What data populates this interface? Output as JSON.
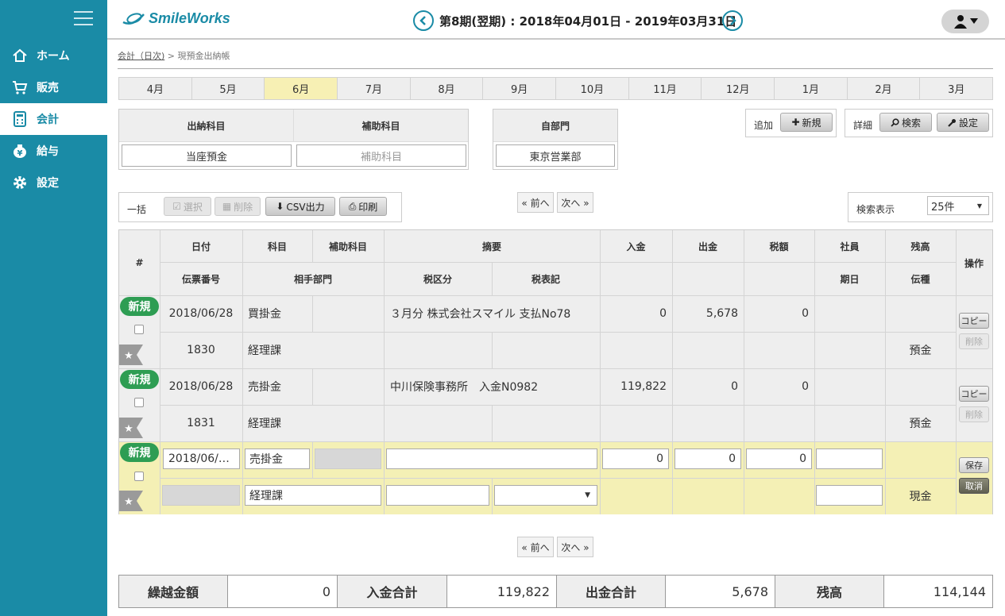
{
  "app": {
    "logo": "SmileWorks"
  },
  "sidebar": {
    "items": [
      {
        "label": "ホーム",
        "icon": "home-icon"
      },
      {
        "label": "販売",
        "icon": "cart-icon"
      },
      {
        "label": "会計",
        "icon": "calculator-icon",
        "active": true
      },
      {
        "label": "給与",
        "icon": "yen-bag-icon"
      },
      {
        "label": "設定",
        "icon": "gear-icon"
      }
    ]
  },
  "header": {
    "period": "第8期(翌期) : 2018年04月01日 - 2019年03月31日"
  },
  "breadcrumb": {
    "parent": "会計（日次)",
    "separator": ">",
    "current": "現預金出納帳"
  },
  "months": [
    "4月",
    "5月",
    "6月",
    "7月",
    "8月",
    "9月",
    "10月",
    "11月",
    "12月",
    "1月",
    "2月",
    "3月"
  ],
  "active_month": "6月",
  "filters": {
    "account_label": "出納科目",
    "account_value": "当座預金",
    "sub_label": "補助科目",
    "sub_placeholder": "補助科目",
    "dept_label": "自部門",
    "dept_value": "東京営業部"
  },
  "toolbar": {
    "add_label": "追加",
    "new_button": "新規",
    "detail_label": "詳細",
    "search_button": "検索",
    "settings_button": "設定",
    "bulk_label": "一括",
    "select_button": "選択",
    "delete_button": "削除",
    "csv_button": "CSV出力",
    "print_button": "印刷",
    "prev": "« 前へ",
    "next": "次へ »",
    "display_label": "検索表示",
    "display_value": "25件"
  },
  "table": {
    "headers": {
      "num": "#",
      "date": "日付",
      "account": "科目",
      "sub": "補助科目",
      "summary": "摘要",
      "deposit": "入金",
      "withdrawal": "出金",
      "tax": "税額",
      "employee": "社員",
      "balance": "残高",
      "ops": "操作",
      "slip_no": "伝票番号",
      "partner_dept": "相手部門",
      "tax_class": "税区分",
      "tax_notation": "税表記",
      "due": "期日",
      "slip_type": "伝種"
    },
    "badge": "新規",
    "copy_button": "コピー",
    "delete_button": "削除",
    "rows": [
      {
        "date": "2018/06/28",
        "account": "買掛金",
        "summary": "３月分 株式会社スマイル 支払No78",
        "deposit": "0",
        "withdrawal": "5,678",
        "tax": "0",
        "slip_no": "1830",
        "dept": "経理課",
        "slip_type": "預金"
      },
      {
        "date": "2018/06/28",
        "account": "売掛金",
        "summary": "中川保険事務所　入金N0982",
        "deposit": "119,822",
        "withdrawal": "0",
        "tax": "0",
        "slip_no": "1831",
        "dept": "経理課",
        "slip_type": "預金"
      }
    ],
    "edit_row": {
      "date": "2018/06/…",
      "account": "売掛金",
      "summary": "",
      "deposit": "0",
      "withdrawal": "0",
      "tax": "0",
      "dept": "経理課",
      "slip_type": "現金",
      "save_button": "保存",
      "cancel_button": "取消"
    }
  },
  "totals": {
    "carry_label": "繰越金額",
    "carry_value": "0",
    "deposit_label": "入金合計",
    "deposit_value": "119,822",
    "withdrawal_label": "出金合計",
    "withdrawal_value": "5,678",
    "balance_label": "残高",
    "balance_value": "114,144"
  },
  "colors": {
    "primary": "#1a8ba6",
    "badge": "#2e9d53",
    "highlight": "#f7f0b4",
    "edit_row": "#f4f0b5"
  }
}
